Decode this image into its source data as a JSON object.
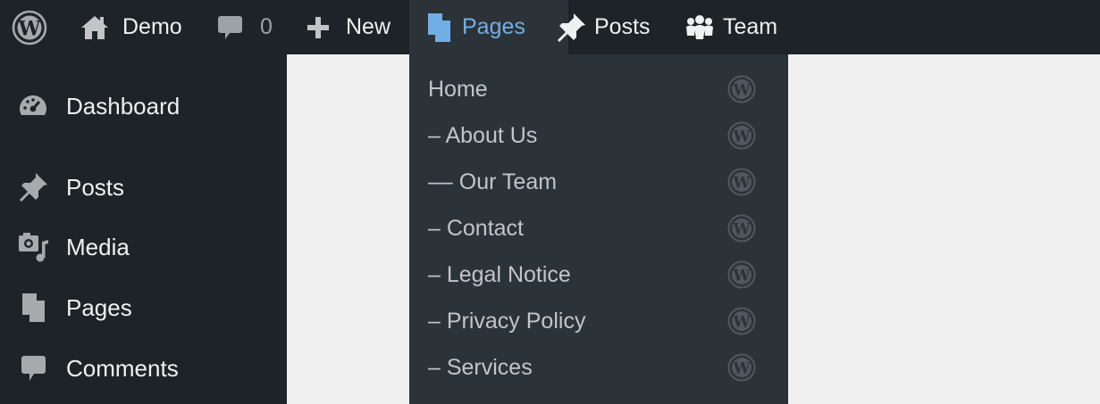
{
  "adminbar": {
    "logo_icon": "wordpress-logo-icon",
    "site": {
      "icon": "home-icon",
      "label": "Demo"
    },
    "comments": {
      "icon": "comment-bubble-icon",
      "count": "0"
    },
    "new": {
      "icon": "plus-icon",
      "label": "New"
    },
    "pages": {
      "icon": "pages-icon",
      "label": "Pages",
      "active": true
    },
    "posts": {
      "icon": "pushpin-icon",
      "label": "Posts"
    },
    "team": {
      "icon": "groups-icon",
      "label": "Team"
    }
  },
  "sidebar": {
    "items": [
      {
        "icon": "dashboard-gauge-icon",
        "label": "Dashboard"
      },
      {
        "icon": "pushpin-icon",
        "label": "Posts"
      },
      {
        "icon": "media-icon",
        "label": "Media"
      },
      {
        "icon": "pages-icon",
        "label": "Pages"
      },
      {
        "icon": "comment-bubble-icon",
        "label": "Comments"
      }
    ]
  },
  "pages_menu": {
    "items": [
      {
        "label": "Home",
        "icon": "wordpress-logo-icon"
      },
      {
        "label": "– About Us",
        "icon": "wordpress-logo-icon"
      },
      {
        "label": "–– Our Team",
        "icon": "wordpress-logo-icon"
      },
      {
        "label": "– Contact",
        "icon": "wordpress-logo-icon"
      },
      {
        "label": "– Legal Notice",
        "icon": "wordpress-logo-icon"
      },
      {
        "label": "– Privacy Policy",
        "icon": "wordpress-logo-icon"
      },
      {
        "label": "– Services",
        "icon": "wordpress-logo-icon"
      }
    ]
  },
  "colors": {
    "adminbar_bg": "#1d2327",
    "submenu_bg": "#2c3338",
    "content_bg": "#f0f0f1",
    "accent": "#72aee6",
    "text": "#f0f0f1",
    "muted": "#9ca2a7"
  }
}
